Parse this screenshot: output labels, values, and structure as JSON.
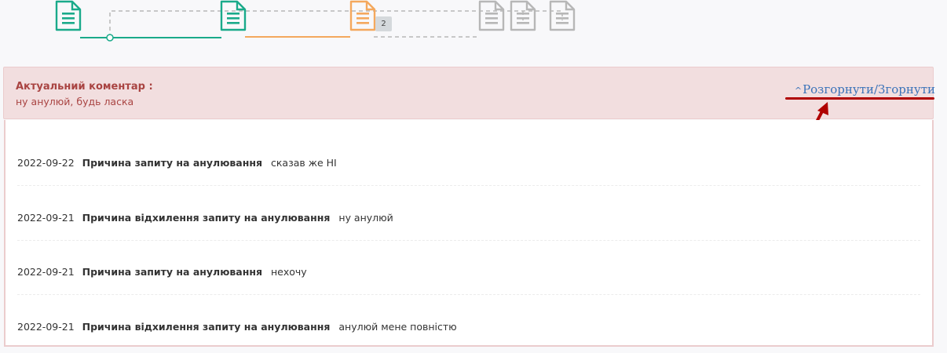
{
  "workflow": {
    "steps": [
      {
        "name": "step-1",
        "status": "done",
        "color": "#1aaa8a"
      },
      {
        "name": "step-2",
        "status": "done",
        "color": "#1aaa8a"
      },
      {
        "name": "step-3",
        "status": "current",
        "color": "#f4a85d"
      },
      {
        "name": "step-4",
        "status": "pending",
        "color": "#b7b7b7"
      },
      {
        "name": "step-5",
        "status": "pending",
        "color": "#b7b7b7"
      },
      {
        "name": "step-6",
        "status": "pending",
        "color": "#b7b7b7"
      }
    ],
    "badge": "2"
  },
  "comment": {
    "title": "Актуальний коментар :",
    "text": "ну анулюй, будь ласка",
    "toggle_caret": "^",
    "toggle_label": "Розгорнути/Згорнути"
  },
  "history": [
    {
      "date": "2022-09-22",
      "label": "Причина запиту на анулювання",
      "value": "сказав же НІ"
    },
    {
      "date": "2022-09-21",
      "label": "Причина відхилення запиту на анулювання",
      "value": "ну анулюй"
    },
    {
      "date": "2022-09-21",
      "label": "Причина запиту на анулювання",
      "value": "нехочу"
    },
    {
      "date": "2022-09-21",
      "label": "Причина відхилення запиту на анулювання",
      "value": "анулюй мене повністю"
    }
  ],
  "colors": {
    "done": "#1aaa8a",
    "current": "#f4a85d",
    "pending": "#b7b7b7",
    "alert_text": "#a94442",
    "alert_bg": "#f2dedf",
    "link": "#3b73b9",
    "annotation": "#b00000"
  }
}
